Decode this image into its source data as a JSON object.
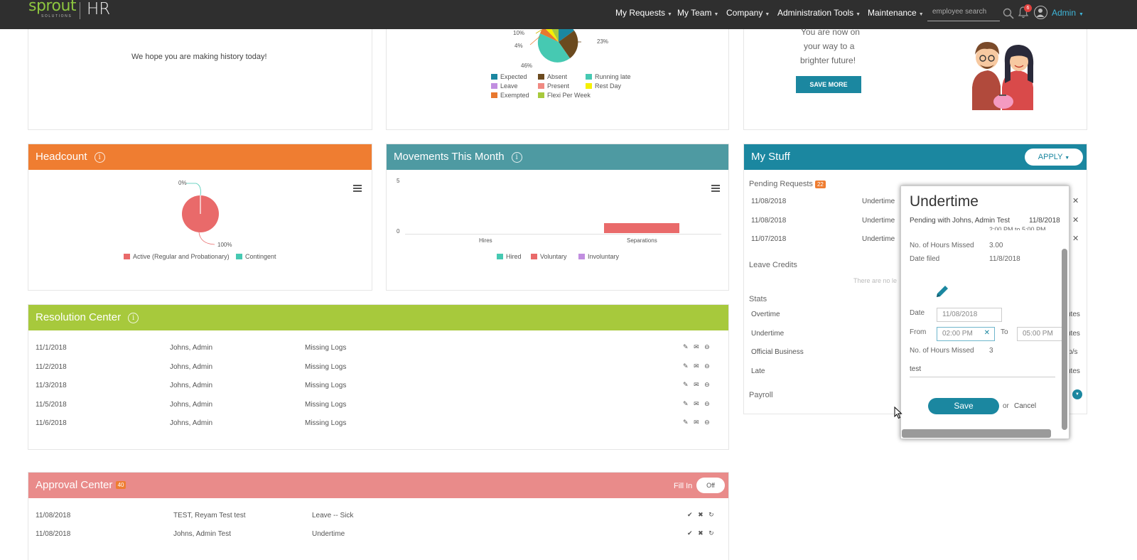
{
  "app": {
    "logo_word": "sprout",
    "logo_sub": "SOLUTIONS",
    "logo_suffix": "HR"
  },
  "nav": {
    "items": [
      "My Requests",
      "My Team",
      "Company",
      "Administration Tools",
      "Maintenance"
    ],
    "search_placeholder": "employee search",
    "notification_count": "6",
    "user": "Admin"
  },
  "greeting": {
    "text": "We hope you are making history today!"
  },
  "attendance_chart": {
    "labels": [
      "10%",
      "4%",
      "46%",
      "23%"
    ],
    "legend": [
      {
        "name": "Expected",
        "color": "#1b87a0"
      },
      {
        "name": "Absent",
        "color": "#6b4a1f"
      },
      {
        "name": "Running late",
        "color": "#46c9b2"
      },
      {
        "name": "Leave",
        "color": "#c18ee0"
      },
      {
        "name": "Present",
        "color": "#f08a82"
      },
      {
        "name": "Rest Day",
        "color": "#f5f000"
      },
      {
        "name": "Exempted",
        "color": "#e8782f"
      },
      {
        "name": "Flexi Per Week",
        "color": "#a7c93c"
      }
    ]
  },
  "savings": {
    "lines": [
      "You are now on",
      "your way to a",
      "brighter future!"
    ],
    "button": "SAVE MORE"
  },
  "headcount": {
    "title": "Headcount",
    "label_top": "0%",
    "label_bottom": "100%",
    "legend": [
      {
        "name": "Active (Regular and Probationary)",
        "color": "#e96a6a"
      },
      {
        "name": "Contingent",
        "color": "#46c9b2"
      }
    ]
  },
  "movements": {
    "title": "Movements This Month",
    "y_ticks": [
      "5",
      "0"
    ],
    "categories": [
      "Hires",
      "Separations"
    ],
    "legend": [
      {
        "name": "Hired",
        "color": "#46c9b2"
      },
      {
        "name": "Voluntary",
        "color": "#e96a6a"
      },
      {
        "name": "Involuntary",
        "color": "#c18ee0"
      }
    ]
  },
  "mystuff": {
    "title": "My Stuff",
    "apply": "APPLY",
    "pending_label": "Pending Requests",
    "pending_count": "22",
    "pending": [
      {
        "date": "11/08/2018",
        "type": "Undertime"
      },
      {
        "date": "11/08/2018",
        "type": "Undertime"
      },
      {
        "date": "11/07/2018",
        "type": "Undertime"
      }
    ],
    "leave_credits": "Leave Credits",
    "leave_empty": "There are no le",
    "stats_label": "Stats",
    "stats": [
      {
        "name": "Overtime",
        "tail": "utes"
      },
      {
        "name": "Undertime",
        "tail": "utes"
      },
      {
        "name": "Official Business",
        "tail": "ip/s"
      },
      {
        "name": "Late",
        "tail": "utes"
      }
    ],
    "payroll": "Payroll"
  },
  "resolution": {
    "title": "Resolution Center",
    "rows": [
      {
        "date": "11/1/2018",
        "name": "Johns, Admin",
        "issue": "Missing Logs"
      },
      {
        "date": "11/2/2018",
        "name": "Johns, Admin",
        "issue": "Missing Logs"
      },
      {
        "date": "11/3/2018",
        "name": "Johns, Admin",
        "issue": "Missing Logs"
      },
      {
        "date": "11/5/2018",
        "name": "Johns, Admin",
        "issue": "Missing Logs"
      },
      {
        "date": "11/6/2018",
        "name": "Johns, Admin",
        "issue": "Missing Logs"
      }
    ]
  },
  "approval": {
    "title": "Approval Center",
    "count": "40",
    "fill_in": "Fill In",
    "toggle": "Off",
    "rows": [
      {
        "date": "11/08/2018",
        "name": "TEST, Reyam Test test",
        "type": "Leave -- Sick"
      },
      {
        "date": "11/08/2018",
        "name": "Johns, Admin Test",
        "type": "Undertime"
      }
    ]
  },
  "popup": {
    "title": "Undertime",
    "status": "Pending with Johns, Admin Test",
    "status_date": "11/8/2018",
    "clipped_line": "2:00 PM to 5:00 PM",
    "hours_missed_label": "No. of Hours Missed",
    "hours_missed_value": "3.00",
    "date_filed_label": "Date filed",
    "date_filed_value": "11/8/2018",
    "date_label": "Date",
    "date_value": "11/08/2018",
    "from_label": "From",
    "from_value": "02:00 PM",
    "to_label": "To",
    "to_value": "05:00 PM",
    "edit_hours_label": "No. of Hours Missed",
    "edit_hours_value": "3",
    "reason": "test",
    "save": "Save",
    "or": "or",
    "cancel": "Cancel"
  }
}
